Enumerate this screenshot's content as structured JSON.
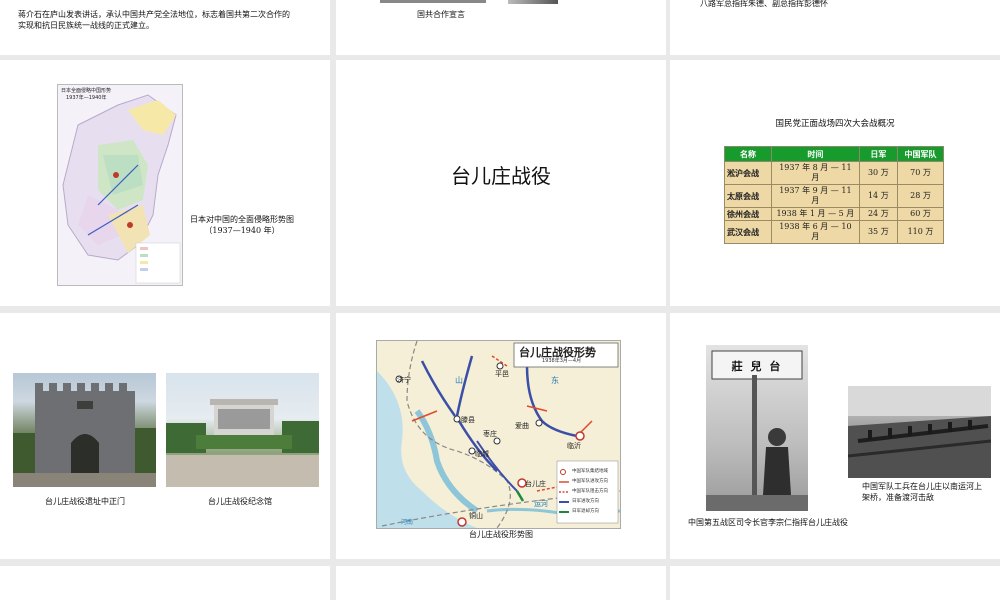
{
  "slides": {
    "top_left": {
      "caption_line1": "蒋介石在庐山发表讲话，承认中国共产党全法地位，标志着国共第二次合作的",
      "caption_line2": "实现和抗日民族统一战线的正式建立。"
    },
    "top_middle": {
      "caption": "国共合作宣言"
    },
    "top_right": {
      "caption": "八路军总指挥朱德、副总指挥彭德怀"
    },
    "mid_left": {
      "map_title_line1": "日本全面侵略中国形势",
      "map_title_line2": "1937年—1940年",
      "caption_line1": "日本对中国的全面侵略形势图",
      "caption_line2": "（1937—1940 年）"
    },
    "mid_middle": {
      "title": "台儿庄战役"
    },
    "mid_right": {
      "title": "国民党正面战场四次大会战概况",
      "headers": [
        "名称",
        "时间",
        "日军",
        "中国军队"
      ],
      "rows": [
        [
          "淞沪会战",
          "1937 年 8 月 — 11 月",
          "30 万",
          "70 万"
        ],
        [
          "太原会战",
          "1937 年 9 月 — 11 月",
          "14 万",
          "28 万"
        ],
        [
          "徐州会战",
          "1938 年 1 月 — 5 月",
          "24 万",
          "60 万"
        ],
        [
          "武汉会战",
          "1938 年 6 月 — 10 月",
          "35 万",
          "110 万"
        ]
      ]
    },
    "bot_left": {
      "caption_gate": "台儿庄战役遗址中正门",
      "caption_memorial": "台儿庄战役纪念馆"
    },
    "bot_middle": {
      "map_title": "台儿庄战役形势",
      "map_subtitle": "1938年3月—4月",
      "places": {
        "jining": "济宁",
        "pingyi": "平邑",
        "tengxian": "滕县",
        "zaozhuang": "枣庄",
        "baoqu": "爱曲",
        "linyi": "临沂",
        "lincheng": "临城",
        "taierzhuang": "台儿庄",
        "tongshan": "铜山",
        "yunhe": "运河",
        "shan": "山",
        "dong": "东",
        "henan": "河南"
      },
      "legend": [
        "中国军队集结地域",
        "中国军队进攻方向",
        "中国军队阻击方向",
        "日军进攻方向",
        "日军退却方向"
      ],
      "caption": "台儿庄战役形势图"
    },
    "bot_right": {
      "sign_text": "莊 兒 台",
      "caption_bridge_line1": "中国军队工兵在台儿庄以南运河上",
      "caption_bridge_line2": "架桥，准备渡河击敌",
      "caption_commander": "中国第五战区司令长官李宗仁指挥台儿庄战役"
    }
  },
  "colors": {
    "table_header_green": "#169b2c",
    "table_cell_tan": "#eed9a6",
    "background_gray": "#e9e9e9"
  }
}
